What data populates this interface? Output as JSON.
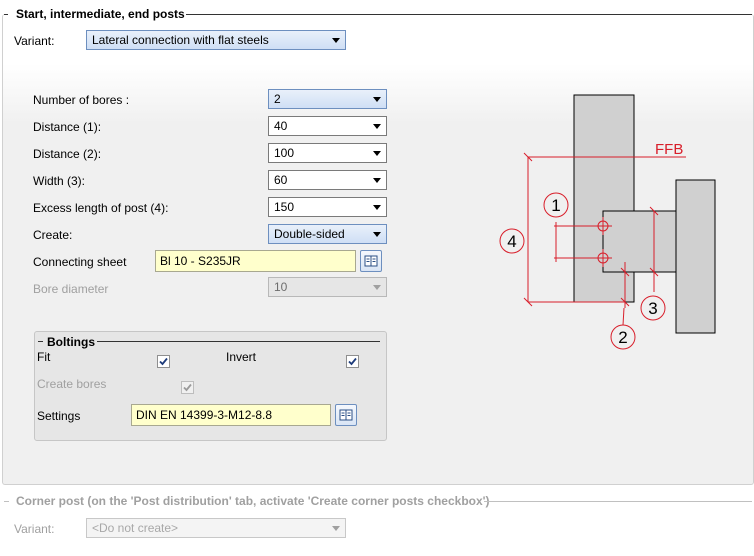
{
  "section_main": {
    "title": "Start, intermediate, end posts",
    "variant_label": "Variant:",
    "variant_value": "Lateral connection with flat steels"
  },
  "fields": [
    {
      "label": "Number of bores :",
      "value": "2"
    },
    {
      "label": "Distance (1):",
      "value": "40"
    },
    {
      "label": "Distance (2):",
      "value": "100"
    },
    {
      "label": "Width (3):",
      "value": "60"
    },
    {
      "label": "Excess length of post (4):",
      "value": "150"
    },
    {
      "label": "Create:",
      "value": "Double-sided"
    }
  ],
  "connecting_sheet": {
    "label": "Connecting sheet",
    "value": "Bl 10 - S235JR"
  },
  "bore_diameter": {
    "label": "Bore diameter",
    "value": "10"
  },
  "boltings": {
    "title": "Boltings",
    "fit_label": "Fit",
    "fit_checked": true,
    "invert_label": "Invert",
    "invert_checked": true,
    "create_bores_label": "Create bores",
    "create_bores_checked": true,
    "settings_label": "Settings",
    "settings_value": "DIN EN 14399-3-M12-8.8"
  },
  "diagram": {
    "ffb_label": "FFB",
    "callouts": [
      "1",
      "2",
      "3",
      "4"
    ],
    "annotation_color": "#d81e2a"
  },
  "section_corner": {
    "title": "Corner post (on the 'Post distribution' tab, activate 'Create corner posts checkbox')",
    "variant_label": "Variant:",
    "variant_value": "<Do not create>"
  }
}
